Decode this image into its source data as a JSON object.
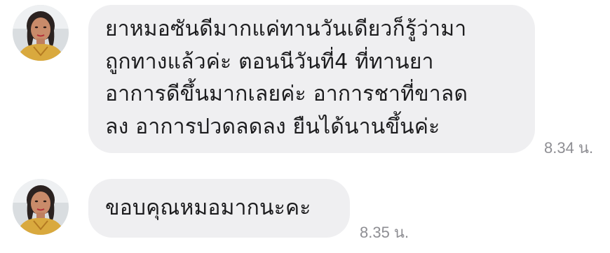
{
  "chat": {
    "messages": [
      {
        "sender_avatar": "user-avatar",
        "lines": [
          "ยาหมอซันดีมากแค่ทานวันเดียวก็รู้ว่ามา",
          "ถูกทางแล้วค่ะ ตอนนีวันที่4 ที่ทานยา",
          "อาการดีขึ้นมากเลยค่ะ อาการชาที่ขาลด",
          "ลง อาการปวดลดลง ยืนได้นานขึ้นค่ะ"
        ],
        "time": "8.34 น."
      },
      {
        "sender_avatar": "user-avatar",
        "lines": [
          "ขอบคุณหมอมากนะคะ"
        ],
        "time": "8.35 น."
      }
    ]
  },
  "colors": {
    "bubble_bg": "#efeff1",
    "text": "#1c1c1e",
    "timestamp": "#8e8e93"
  }
}
